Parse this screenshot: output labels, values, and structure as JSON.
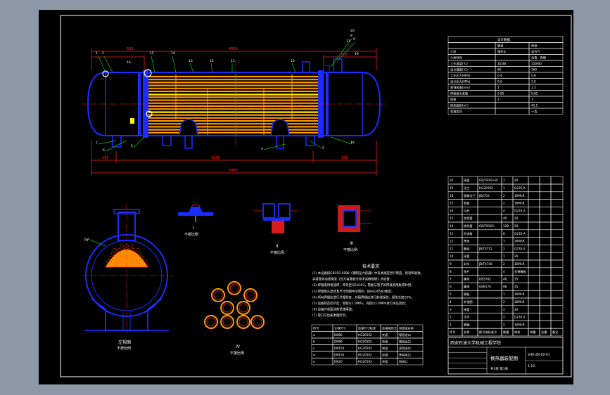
{
  "view": {
    "background": "#8c98a8",
    "paper_color": "#000000",
    "frame_color": "#ffffff"
  },
  "colors": {
    "vessel_outline": "#1a2cff",
    "tube_bundle": "#ff9900",
    "dimension_lines": "#ff2020",
    "leader_lines": "#00d000",
    "text": "#ffffff"
  },
  "main_view": {
    "part_numbers": [
      "1",
      "2",
      "15",
      "14",
      "13",
      "12",
      "11",
      "10",
      "9",
      "8",
      "7",
      "6",
      "5",
      "4",
      "3",
      "18",
      "19",
      "20",
      "17",
      "16"
    ],
    "dims": {
      "left": "500",
      "mid": "4000",
      "right": "500",
      "total": "5000",
      "bottom1": "150",
      "bottom2": "1500",
      "bottom3": "150"
    }
  },
  "side_view": {
    "title": "左视图",
    "subtitle": "不按比例",
    "callout": "IV"
  },
  "details": [
    {
      "id": "I",
      "caption": "不按比例"
    },
    {
      "id": "II",
      "caption": "不按比例"
    },
    {
      "id": "III",
      "caption": "不按比例"
    },
    {
      "id": "IV",
      "caption": "不按比例"
    }
  ],
  "tech_requirements": {
    "title": "技术要求",
    "lines": [
      "(1) 本设备按GB150-1998《钢制压力容器》中有关规定进行制造、检验和验收，",
      "    并接受劳动部颁发《压力容器安全技术监察规程》的监督；",
      "(2) 焊接采用电弧焊，焊条型号E4303，管板与管子的焊接采用胀焊并用；",
      "(3) 焊接接头型式及尺寸除图中注明外，按HG20583规定；",
      "(4) 所有焊缝应进行外观检查，对接焊缝应进行射线探伤，探伤长度20%；",
      "(5) 设备制造完毕后，管程以1.0MPa，壳程以1.0MPa进行水压试验；",
      "(6) 设备外表面涂防锈漆两道；",
      "(7) 管口方位按本图所示。"
    ]
  },
  "nozzle_table": {
    "headers": [
      "符号",
      "公称尺寸",
      "连接尺寸标准",
      "连接面形式",
      "用途或名称"
    ],
    "rows": [
      [
        "a",
        "DN80",
        "HG20592",
        "突面",
        "管程进口"
      ],
      [
        "b",
        "DN80",
        "HG20592",
        "突面",
        "管程出口"
      ],
      [
        "c",
        "DN150",
        "HG20592",
        "突面",
        "壳程进口"
      ],
      [
        "d",
        "DN150",
        "HG20592",
        "突面",
        "壳程出口"
      ],
      [
        "e",
        "DN20",
        "HG20592",
        "突面",
        "排液口"
      ]
    ]
  },
  "design_data": {
    "title": "设计数据",
    "headers": [
      "",
      "管程",
      "壳程"
    ],
    "rows": [
      [
        "介质",
        "循环水",
        "混合气"
      ],
      [
        "介质特性",
        "",
        "无毒、易燃"
      ],
      [
        "工作温度(℃)",
        "32/38",
        "150/60"
      ],
      [
        "设计温度(℃)",
        "60",
        "160"
      ],
      [
        "工作压力(MPa)",
        "0.4",
        "0.8"
      ],
      [
        "设计压力(MPa)",
        "0.6",
        "1.0"
      ],
      [
        "腐蚀裕量(mm)",
        "1",
        "1.5"
      ],
      [
        "焊接接头系数",
        "0.85",
        "0.85"
      ],
      [
        "程数",
        "2",
        "1"
      ],
      [
        "换热面积(m²)",
        "",
        "42.5"
      ],
      [
        "容器类别",
        "",
        "一类"
      ]
    ]
  },
  "bom": {
    "rows": [
      [
        "20",
        "接管",
        "GB/T8163-87",
        "1",
        "20",
        "",
        "",
        ""
      ],
      [
        "19",
        "法兰",
        "HG20592",
        "1",
        "Q235-A",
        "",
        "",
        ""
      ],
      [
        "18",
        "管箱法兰",
        "JB4703",
        "2",
        "16MnR",
        "",
        "",
        ""
      ],
      [
        "17",
        "管板",
        "",
        "2",
        "16MnR",
        "",
        "",
        ""
      ],
      [
        "16",
        "拉杆",
        "",
        "4",
        "Q235-A",
        "",
        "",
        ""
      ],
      [
        "15",
        "定距管",
        "",
        "40",
        "20",
        "",
        "",
        ""
      ],
      [
        "14",
        "换热管",
        "GB/T8163",
        "128",
        "20",
        "",
        "",
        ""
      ],
      [
        "13",
        "折流板",
        "",
        "8",
        "Q235-A",
        "",
        "",
        ""
      ],
      [
        "12",
        "筒体",
        "",
        "1",
        "16MnR",
        "",
        "",
        ""
      ],
      [
        "11",
        "鞍座",
        "JB/T4712",
        "2",
        "Q235-A",
        "",
        "",
        ""
      ],
      [
        "10",
        "接管",
        "",
        "1",
        "20",
        "",
        "",
        ""
      ],
      [
        "9",
        "封头",
        "JB/T4746",
        "2",
        "16MnR",
        "",
        "",
        ""
      ],
      [
        "8",
        "垫片",
        "",
        "4",
        "石棉橡胶",
        "",
        "",
        ""
      ],
      [
        "7",
        "螺栓",
        "GB5782",
        "48",
        "35",
        "",
        "",
        ""
      ],
      [
        "6",
        "螺母",
        "GB6170",
        "96",
        "25",
        "",
        "",
        ""
      ],
      [
        "5",
        "隔板",
        "",
        "1",
        "16MnR",
        "",
        "",
        ""
      ],
      [
        "4",
        "补强圈",
        "",
        "2",
        "16MnR",
        "",
        "",
        ""
      ],
      [
        "3",
        "接管",
        "",
        "2",
        "20",
        "",
        "",
        ""
      ],
      [
        "2",
        "法兰",
        "",
        "2",
        "Q235-A",
        "",
        "",
        ""
      ],
      [
        "1",
        "管箱",
        "",
        "2",
        "16MnR",
        "",
        "",
        ""
      ]
    ],
    "header": [
      "件号",
      "名称",
      "图号或标准号",
      "数量",
      "材料",
      "单重",
      "总重",
      "备注"
    ]
  },
  "title_block": {
    "school": "西安石油大学机械工程学院",
    "drawing_title": "换热器装配图",
    "drawing_no": "SHR-ZB-00-01",
    "scale": "1:10",
    "sheet": "共1张 第1张"
  }
}
